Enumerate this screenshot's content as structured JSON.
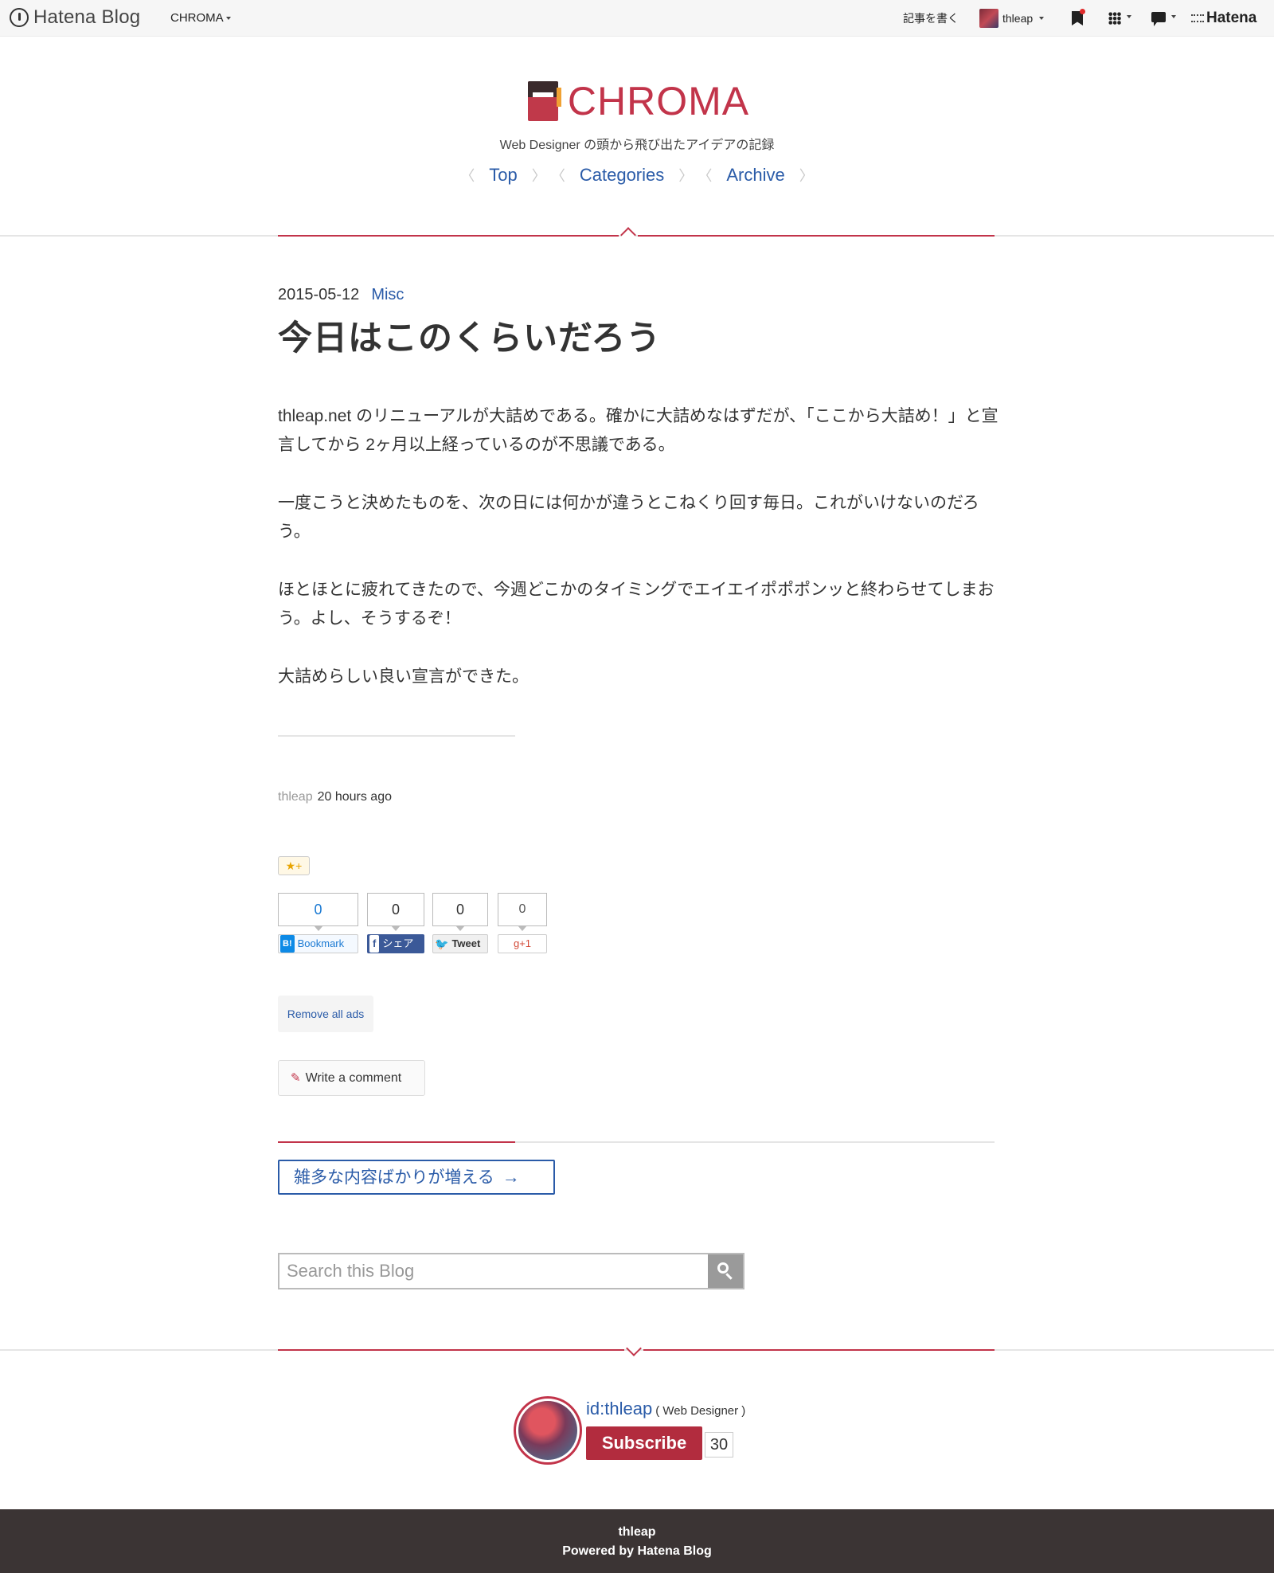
{
  "topbar": {
    "logo_text": "Hatena Blog",
    "blog_name": "CHROMA",
    "write_label": "記事を書く",
    "user_name": "thleap",
    "hatena_label": "Hatena"
  },
  "header": {
    "title": "CHROMA",
    "description": "Web Designer の頭から飛び出たアイデアの記録",
    "nav": [
      "Top",
      "Categories",
      "Archive"
    ]
  },
  "entry": {
    "date": "2015-05-12",
    "category": "Misc",
    "title": "今日はこのくらいだろう",
    "paragraphs": [
      "thleap.net のリニューアルが大詰めである。確かに大詰めなはずだが、「ここから大詰め！」と宣言してから 2ヶ月以上経っているのが不思議である。",
      "一度こうと決めたものを、次の日には何かが違うとこねくり回す毎日。これがいけないのだろう。",
      "ほとほとに疲れてきたので、今週どこかのタイミングでエイエイポポポンッと終わらせてしまおう。よし、そうするぞ！",
      "大詰めらしい良い宣言ができた。"
    ],
    "author": "thleap",
    "time_ago": "20 hours ago"
  },
  "social": {
    "star_label": "★+",
    "bookmark": {
      "count": "0",
      "label": "Bookmark",
      "icon": "B!"
    },
    "facebook": {
      "count": "0",
      "label": "シェア",
      "icon": "f"
    },
    "twitter": {
      "count": "0",
      "label": "Tweet",
      "icon": "🐦"
    },
    "gplus": {
      "count": "0",
      "label": "g+1"
    }
  },
  "actions": {
    "remove_ads": "Remove all ads",
    "write_comment": "Write a comment"
  },
  "pager": {
    "next_title": "雑多な内容ばかりが増える",
    "arrow": "→"
  },
  "search": {
    "placeholder": "Search this Blog"
  },
  "profile": {
    "id": "id:thleap",
    "role": "( Web Designer )",
    "subscribe_label": "Subscribe",
    "subscriber_count": "30"
  },
  "footer": {
    "line1": "thleap",
    "line2": "Powered by Hatena Blog"
  },
  "colors": {
    "accent": "#c2344a",
    "link": "#2a5ba8",
    "footer_bg": "#3b3434"
  }
}
